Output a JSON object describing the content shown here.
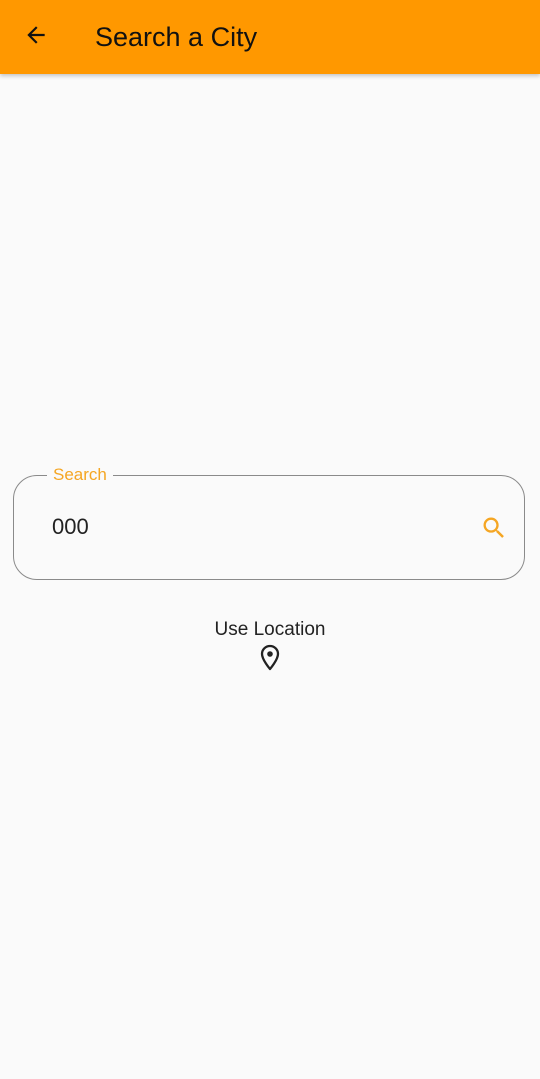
{
  "app_bar": {
    "title": "Search a City",
    "back_icon": "arrow-back-icon",
    "background_color": "#ff9800"
  },
  "search": {
    "label": "Search",
    "value": "000",
    "icon": "search-icon",
    "accent_color": "#f5a623"
  },
  "location": {
    "label": "Use Location",
    "icon": "location-pin-icon"
  }
}
